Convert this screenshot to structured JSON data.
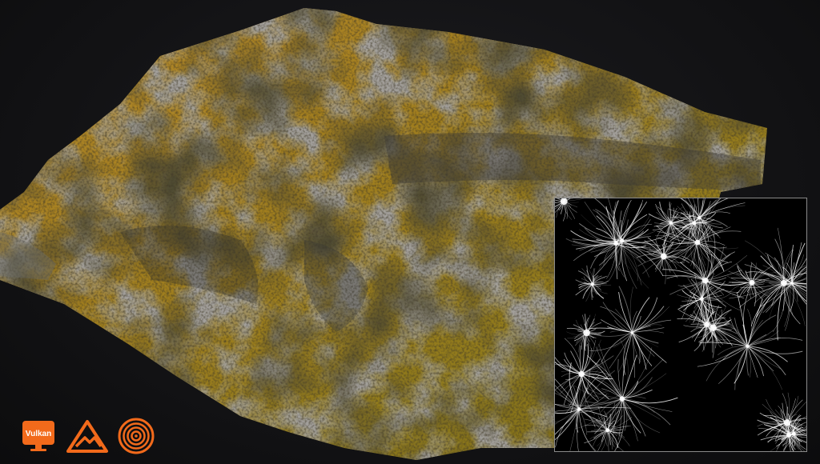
{
  "scene": {
    "background_color": "#121214",
    "accent_color": "#f26a1b",
    "subject": "terrain-render",
    "inset_subject": "flow-map"
  },
  "logos": {
    "vulkan": {
      "label": "Vulkan",
      "icon": "monitor-icon"
    },
    "mountain": {
      "icon": "mountain-icon"
    },
    "target": {
      "icon": "concentric-rings-icon"
    }
  }
}
